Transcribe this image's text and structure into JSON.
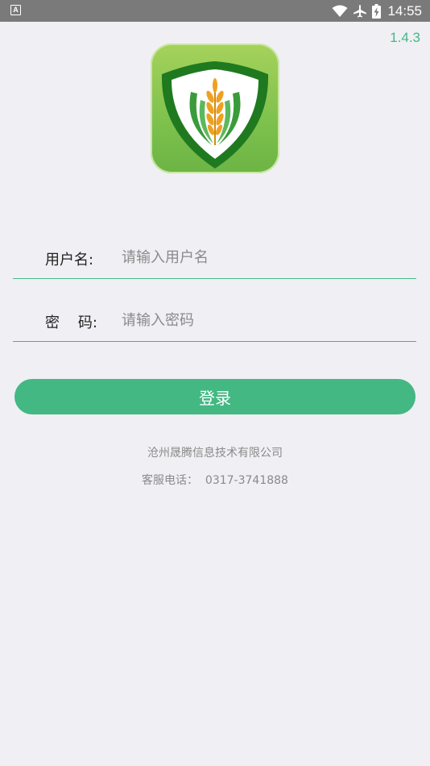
{
  "status_bar": {
    "notification_icon_letter": "A",
    "time": "14:55",
    "icons": [
      "wifi-icon",
      "airplane-icon",
      "battery-charging-icon"
    ]
  },
  "app": {
    "version": "1.4.3",
    "logo_icon": "wheat-shield-logo",
    "colors": {
      "accent": "#43b883",
      "background": "#f0eff4"
    }
  },
  "form": {
    "username": {
      "label": "用户名:",
      "placeholder": "请输入用户名",
      "value": ""
    },
    "password": {
      "label": "密    码:",
      "placeholder": "请输入密码",
      "value": ""
    },
    "login_label": "登录"
  },
  "footer": {
    "company": "沧州晟腾信息技术有限公司",
    "phone": "客服电话：  0317-3741888"
  }
}
